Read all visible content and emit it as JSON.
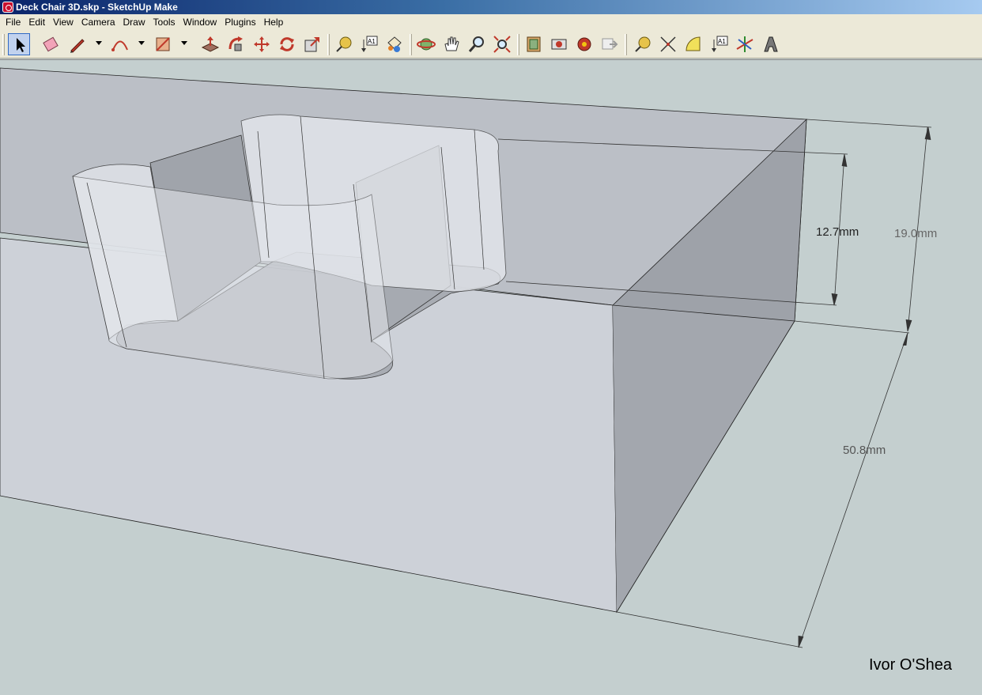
{
  "window": {
    "title": "Deck Chair 3D.skp - SketchUp Make"
  },
  "menu": [
    "File",
    "Edit",
    "View",
    "Camera",
    "Draw",
    "Tools",
    "Window",
    "Plugins",
    "Help"
  ],
  "toolbar": {
    "tools": [
      {
        "icon": "select-icon",
        "active": true
      },
      {
        "icon": "eraser-icon"
      },
      {
        "icon": "pencil-line-icon"
      },
      {
        "icon": "arc-icon"
      },
      {
        "icon": "rectangle-icon"
      },
      {
        "icon": "push-pull-icon"
      },
      {
        "icon": "follow-me-icon"
      },
      {
        "icon": "move-icon"
      },
      {
        "icon": "rotate-icon"
      },
      {
        "icon": "scale-icon"
      },
      {
        "icon": "tape-measure-icon"
      },
      {
        "icon": "text-label-icon"
      },
      {
        "icon": "paint-bucket-icon"
      },
      {
        "icon": "orbit-icon"
      },
      {
        "icon": "pan-icon"
      },
      {
        "icon": "zoom-icon"
      },
      {
        "icon": "zoom-extents-icon"
      },
      {
        "icon": "get-models-icon"
      },
      {
        "icon": "share-model-icon"
      },
      {
        "icon": "extension-warehouse-icon"
      },
      {
        "icon": "send-to-layout-icon"
      },
      {
        "icon": "tape-measure-2-icon"
      },
      {
        "icon": "dimension-icon"
      },
      {
        "icon": "protractor-icon"
      },
      {
        "icon": "text-tool-icon"
      },
      {
        "icon": "axes-icon"
      },
      {
        "icon": "3d-text-icon"
      }
    ]
  },
  "dimensions": {
    "inner_depth": "12.7mm",
    "thickness": "19.0mm",
    "width": "50.8mm"
  },
  "watermark": "Ivor O'Shea",
  "colors": {
    "sky": "#c4cfcf",
    "top_face": "#bcc0c6",
    "front_face": "#cdd1d8",
    "side_face": "#9ea2a9"
  }
}
